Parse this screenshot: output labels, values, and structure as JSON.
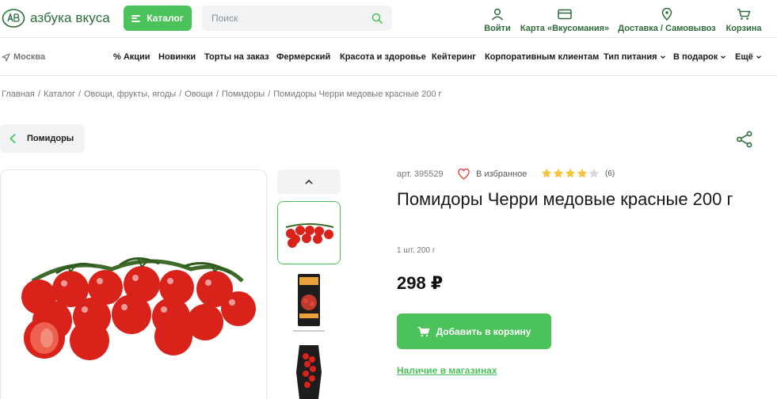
{
  "brand": {
    "name": "азбука вкуса",
    "logo_mark": "АВ",
    "color": "#2d6b3a",
    "accent": "#4cc35a"
  },
  "header": {
    "catalog_label": "Каталог",
    "search_placeholder": "Поиск",
    "actions": [
      {
        "label": "Войти",
        "icon": "user-icon"
      },
      {
        "label": "Карта «Вкусомания»",
        "icon": "card-icon"
      },
      {
        "label": "Доставка / Самовывоз",
        "icon": "location-pin-icon"
      },
      {
        "label": "Корзина",
        "icon": "cart-icon"
      }
    ]
  },
  "nav": {
    "city": "Москва",
    "items": [
      {
        "label": "% Акции"
      },
      {
        "label": "Новинки"
      },
      {
        "label": "Торты на заказ"
      },
      {
        "label": "Фермерский"
      },
      {
        "label": "Красота и здоровье"
      },
      {
        "label": "Кейтеринг"
      },
      {
        "label": "Корпоративным клиентам"
      },
      {
        "label": "Тип питания"
      },
      {
        "label": "В подарок"
      },
      {
        "label": "Ещё"
      }
    ]
  },
  "breadcrumb": [
    "Главная",
    "Каталог",
    "Овощи, фрукты, ягоды",
    "Овощи",
    "Помидоры",
    "Помидоры Черри медовые красные 200 г"
  ],
  "back_label": "Помидоры",
  "product": {
    "sku": "арт. 395529",
    "favorite_label": "В избранное",
    "rating": 4,
    "rating_max": 5,
    "rating_count": "(6)",
    "title": "Помидоры Черри медовые красные 200 г",
    "quantity": "1 шт, 200 г",
    "price": "298 ₽",
    "add_to_cart_label": "Добавить в корзину",
    "stock_link": "Наличие в магазинах"
  }
}
